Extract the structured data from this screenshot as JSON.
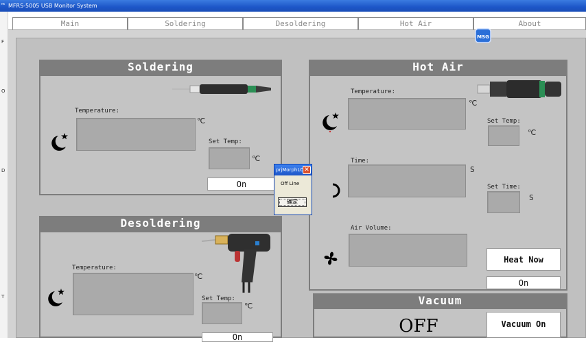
{
  "window": {
    "title": "MFRS-5005 USB  Monitor System",
    "logo": "™"
  },
  "tabs": [
    {
      "label": "Main"
    },
    {
      "label": "Soldering"
    },
    {
      "label": "Desoldering"
    },
    {
      "label": "Hot Air"
    },
    {
      "label": "About"
    }
  ],
  "msg_badge": "MSG",
  "soldering": {
    "title": "Soldering",
    "temperature_label": "Temperature:",
    "temp_unit": "℃",
    "set_temp_label": "Set Temp:",
    "set_temp_unit": "℃",
    "on_button": "On"
  },
  "desoldering": {
    "title": "Desoldering",
    "temperature_label": "Temperature:",
    "temp_unit": "℃",
    "set_temp_label": "Set Temp:",
    "set_temp_unit": "℃",
    "on_button": "On"
  },
  "hot_air": {
    "title": "Hot Air",
    "temperature_label": "Temperature:",
    "temp_unit": "℃",
    "set_temp_label": "Set Temp:",
    "set_temp_unit": "℃",
    "time_label": "Time:",
    "time_unit": "S",
    "set_time_label": "Set Time:",
    "set_time_unit": "S",
    "air_volume_label": "Air Volume:",
    "heat_now_button": "Heat Now",
    "on_button": "On"
  },
  "vacuum": {
    "title": "Vacuum",
    "status": "OFF",
    "vacuum_on_button": "Vacuum On"
  },
  "dialog": {
    "title": "prjMorphLCD",
    "message": "Off Line",
    "ok_button": "确定",
    "close": "✕"
  }
}
